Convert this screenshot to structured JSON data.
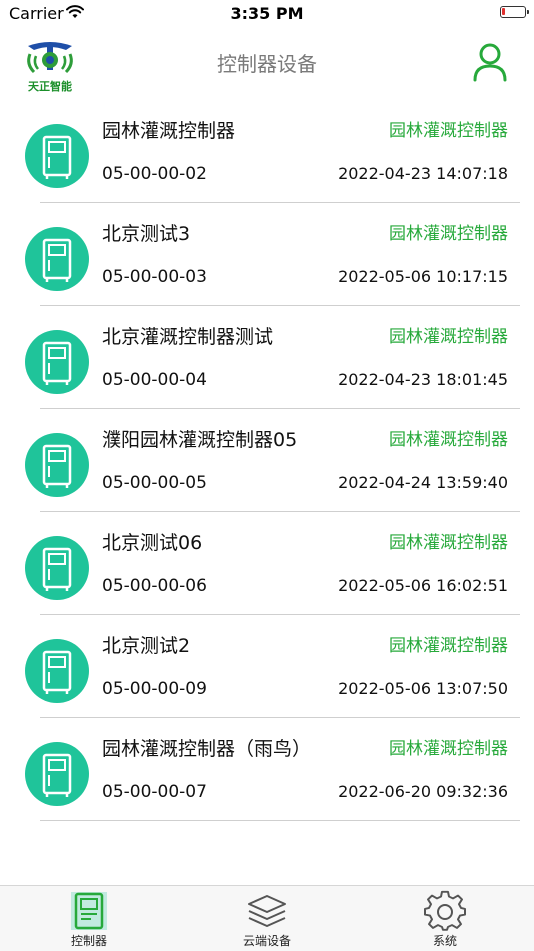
{
  "status_bar": {
    "carrier": "Carrier",
    "time": "3:35 PM",
    "battery_level": 0.15
  },
  "header": {
    "logo_text": "天正智能",
    "title": "控制器设备",
    "user_icon": "user-icon"
  },
  "devices": [
    {
      "name": "园林灌溉控制器",
      "type": "园林灌溉控制器",
      "id": "05-00-00-02",
      "time": "2022-04-23 14:07:18"
    },
    {
      "name": "北京测试3",
      "type": "园林灌溉控制器",
      "id": "05-00-00-03",
      "time": "2022-05-06 10:17:15"
    },
    {
      "name": "北京灌溉控制器测试",
      "type": "园林灌溉控制器",
      "id": "05-00-00-04",
      "time": "2022-04-23 18:01:45"
    },
    {
      "name": "濮阳园林灌溉控制器05",
      "type": "园林灌溉控制器",
      "id": "05-00-00-05",
      "time": "2022-04-24 13:59:40"
    },
    {
      "name": "北京测试06",
      "type": "园林灌溉控制器",
      "id": "05-00-00-06",
      "time": "2022-05-06 16:02:51"
    },
    {
      "name": "北京测试2",
      "type": "园林灌溉控制器",
      "id": "05-00-00-09",
      "time": "2022-05-06 13:07:50"
    },
    {
      "name": "园林灌溉控制器（雨鸟）",
      "type": "园林灌溉控制器",
      "id": "05-00-00-07",
      "time": "2022-06-20 09:32:36"
    }
  ],
  "tabs": [
    {
      "label": "控制器",
      "icon": "controller-icon",
      "active": true
    },
    {
      "label": "云端设备",
      "icon": "layers-icon",
      "active": false
    },
    {
      "label": "系统",
      "icon": "gear-icon",
      "active": false
    }
  ],
  "colors": {
    "accent_green": "#27a93b",
    "icon_teal": "#1fc49a",
    "title_gray": "#7a7a7a"
  }
}
